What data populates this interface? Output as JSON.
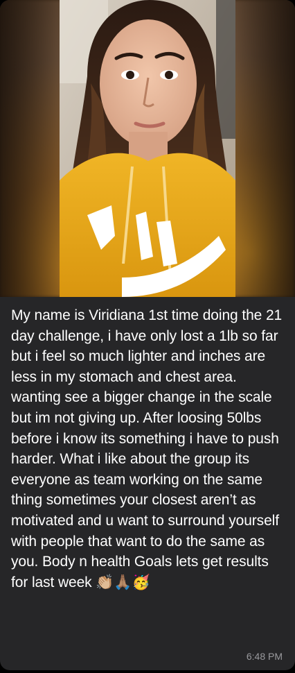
{
  "message": {
    "text": "My name is Viridiana 1st time doing the 21 day challenge, i have only lost a 1lb so far but i feel so much lighter and inches are less in my stomach and chest area. wanting see a bigger change in the scale but im not giving up. After loosing 50lbs before i know its something i have to push harder. What i like about the group its everyone as team working on the same thing sometimes your closest aren’t as motivated and u want to surround yourself with people that want to do the same as you. Body n health Goals lets get results for last week",
    "emojis": "👏🏼🙏🏽🥳",
    "timestamp": "6:48 PM"
  },
  "photo": {
    "subject": "selfie-photo",
    "hoodie_color": "#e6a418",
    "bubble_color": "#262628"
  }
}
